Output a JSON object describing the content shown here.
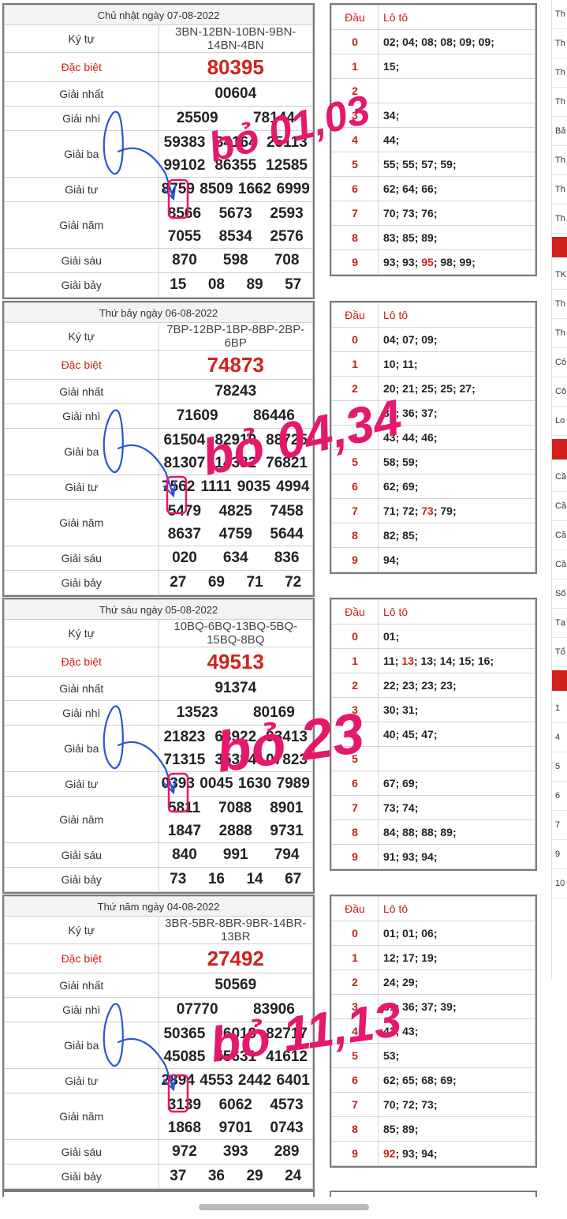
{
  "draws": [
    {
      "date": "Chủ nhật ngày 07-08-2022",
      "ky_tu": "3BN-12BN-10BN-9BN-14BN-4BN",
      "dac_biet": "80395",
      "nhat": "00604",
      "nhi": [
        "25509",
        "78144"
      ],
      "ba": [
        "59383",
        "34164",
        "25113",
        "99102",
        "86355",
        "12585"
      ],
      "tu": [
        "8759",
        "8509",
        "1662",
        "6999"
      ],
      "nam": [
        "8566",
        "5673",
        "2593",
        "7055",
        "8534",
        "2576"
      ],
      "sau": [
        "870",
        "598",
        "708"
      ],
      "bay": [
        "15",
        "08",
        "89",
        "57"
      ],
      "loto": [
        "02; 04; 08; 08; 09; 09;",
        "15;",
        "",
        "34;",
        "44;",
        "55; 55; 57; 59;",
        "62; 64; 66;",
        "70; 73; 76;",
        "83; 85; 89;",
        "93; 93; 95; 98; 99;"
      ],
      "annotation": "bỏ 01,03"
    },
    {
      "date": "Thứ bảy ngày 06-08-2022",
      "ky_tu": "7BP-12BP-1BP-8BP-2BP-6BP",
      "dac_biet": "74873",
      "nhat": "78243",
      "nhi": [
        "71609",
        "86446"
      ],
      "ba": [
        "61504",
        "82910",
        "88725",
        "81307",
        "14382",
        "76821"
      ],
      "tu": [
        "7562",
        "1111",
        "9035",
        "4994"
      ],
      "nam": [
        "5479",
        "4825",
        "7458",
        "8637",
        "4759",
        "5644"
      ],
      "sau": [
        "020",
        "634",
        "836"
      ],
      "bay": [
        "27",
        "69",
        "71",
        "72"
      ],
      "loto": [
        "04; 07; 09;",
        "10; 11;",
        "20; 21; 25; 25; 27;",
        "34; 36; 37;",
        "43; 44; 46;",
        "58; 59;",
        "62; 69;",
        "71; 72; 73; 79;",
        "82; 85;",
        "94;"
      ],
      "annotation": "bỏ 04,34"
    },
    {
      "date": "Thứ sáu ngày 05-08-2022",
      "ky_tu": "10BQ-6BQ-13BQ-5BQ-15BQ-8BQ",
      "dac_biet": "49513",
      "nhat": "91374",
      "nhi": [
        "13523",
        "80169"
      ],
      "ba": [
        "21823",
        "68922",
        "93413",
        "71315",
        "35384",
        "07823"
      ],
      "tu": [
        "0393",
        "0045",
        "1630",
        "7989"
      ],
      "nam": [
        "5811",
        "7088",
        "8901",
        "1847",
        "2888",
        "9731"
      ],
      "sau": [
        "840",
        "991",
        "794"
      ],
      "bay": [
        "73",
        "16",
        "14",
        "67"
      ],
      "loto": [
        "01;",
        "11; 13; 13; 14; 15; 16;",
        "22; 23; 23; 23;",
        "30; 31;",
        "40; 45; 47;",
        "",
        "67; 69;",
        "73; 74;",
        "84; 88; 88; 89;",
        "91; 93; 94;"
      ],
      "annotation": "bỏ 23"
    },
    {
      "date": "Thứ năm ngày 04-08-2022",
      "ky_tu": "3BR-5BR-8BR-9BR-14BR-13BR",
      "dac_biet": "27492",
      "nhat": "50569",
      "nhi": [
        "07770",
        "83906"
      ],
      "ba": [
        "50365",
        "06019",
        "82717",
        "45085",
        "55631",
        "41612"
      ],
      "tu": [
        "2894",
        "4553",
        "2442",
        "6401"
      ],
      "nam": [
        "3139",
        "6062",
        "4573",
        "1868",
        "9701",
        "0743"
      ],
      "sau": [
        "972",
        "393",
        "289"
      ],
      "bay": [
        "37",
        "36",
        "29",
        "24"
      ],
      "loto": [
        "01; 01; 06;",
        "12; 17; 19;",
        "24; 29;",
        "31; 36; 37; 39;",
        "42; 43;",
        "53;",
        "62; 65; 68; 69;",
        "70; 72; 73;",
        "85; 89;",
        "92; 93; 94;"
      ],
      "annotation": "bỏ 11,13"
    }
  ],
  "labels": {
    "ky_tu": "Ký tự",
    "dac_biet": "Đặc biệt",
    "nhat": "Giải nhất",
    "nhi": "Giải nhì",
    "ba": "Giải ba",
    "tu": "Giải tư",
    "nam": "Giải năm",
    "sau": "Giải sáu",
    "bay": "Giải bảy",
    "dau": "Đầu",
    "loto": "Lô tô"
  },
  "sidebar": [
    "Th",
    "Th lot",
    "Th",
    "Th",
    "Bả",
    "Th the",
    "Th",
    "Th",
    "TK",
    "Th",
    "Th",
    "Cô",
    "Cô VII",
    "Lo",
    "Cầ",
    "Cầ",
    "Cầ",
    "Cầ",
    "Số",
    "Tạ",
    "Tổ",
    "1",
    "4",
    "5",
    "6",
    "7",
    "9",
    "10"
  ],
  "colors": {
    "accent": "#d0211c",
    "annotation_pink": "#e6186b",
    "annotation_blue": "#2a55d6"
  }
}
